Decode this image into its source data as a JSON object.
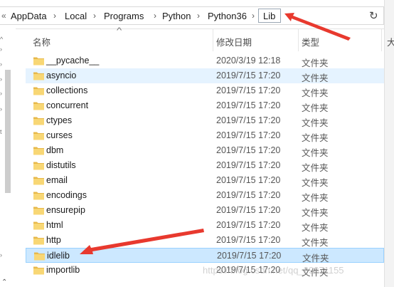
{
  "address_bar": {
    "crumbs": [
      "AppData",
      "Local",
      "Programs",
      "Python",
      "Python36",
      "Lib"
    ],
    "overflow_glyph": "«",
    "separator": "›"
  },
  "columns": {
    "name": "名称",
    "date": "修改日期",
    "type": "类型",
    "size": "大"
  },
  "files": [
    {
      "name": "__pycache__",
      "date": "2020/3/19 12:18",
      "type": "文件夹"
    },
    {
      "name": "asyncio",
      "date": "2019/7/15 17:20",
      "type": "文件夹",
      "state": "hover"
    },
    {
      "name": "collections",
      "date": "2019/7/15 17:20",
      "type": "文件夹"
    },
    {
      "name": "concurrent",
      "date": "2019/7/15 17:20",
      "type": "文件夹"
    },
    {
      "name": "ctypes",
      "date": "2019/7/15 17:20",
      "type": "文件夹"
    },
    {
      "name": "curses",
      "date": "2019/7/15 17:20",
      "type": "文件夹"
    },
    {
      "name": "dbm",
      "date": "2019/7/15 17:20",
      "type": "文件夹"
    },
    {
      "name": "distutils",
      "date": "2019/7/15 17:20",
      "type": "文件夹"
    },
    {
      "name": "email",
      "date": "2019/7/15 17:20",
      "type": "文件夹"
    },
    {
      "name": "encodings",
      "date": "2019/7/15 17:20",
      "type": "文件夹"
    },
    {
      "name": "ensurepip",
      "date": "2019/7/15 17:20",
      "type": "文件夹"
    },
    {
      "name": "html",
      "date": "2019/7/15 17:20",
      "type": "文件夹"
    },
    {
      "name": "http",
      "date": "2019/7/15 17:20",
      "type": "文件夹"
    },
    {
      "name": "idlelib",
      "date": "2019/7/15 17:20",
      "type": "文件夹",
      "state": "selected"
    },
    {
      "name": "importlib",
      "date": "2019/7/15 17:20",
      "type": "文件夹"
    }
  ],
  "watermark": "https://blog.csdn.net/qq_29371155",
  "colors": {
    "arrow": "#e8392e",
    "folder": "#f8d775",
    "folder_dark": "#e7b84a",
    "selected": "#cce8ff",
    "hover": "#e5f3ff"
  },
  "icons": {
    "folder": "folder-icon",
    "refresh": "refresh-icon",
    "sort": "sort-ascending-icon"
  }
}
